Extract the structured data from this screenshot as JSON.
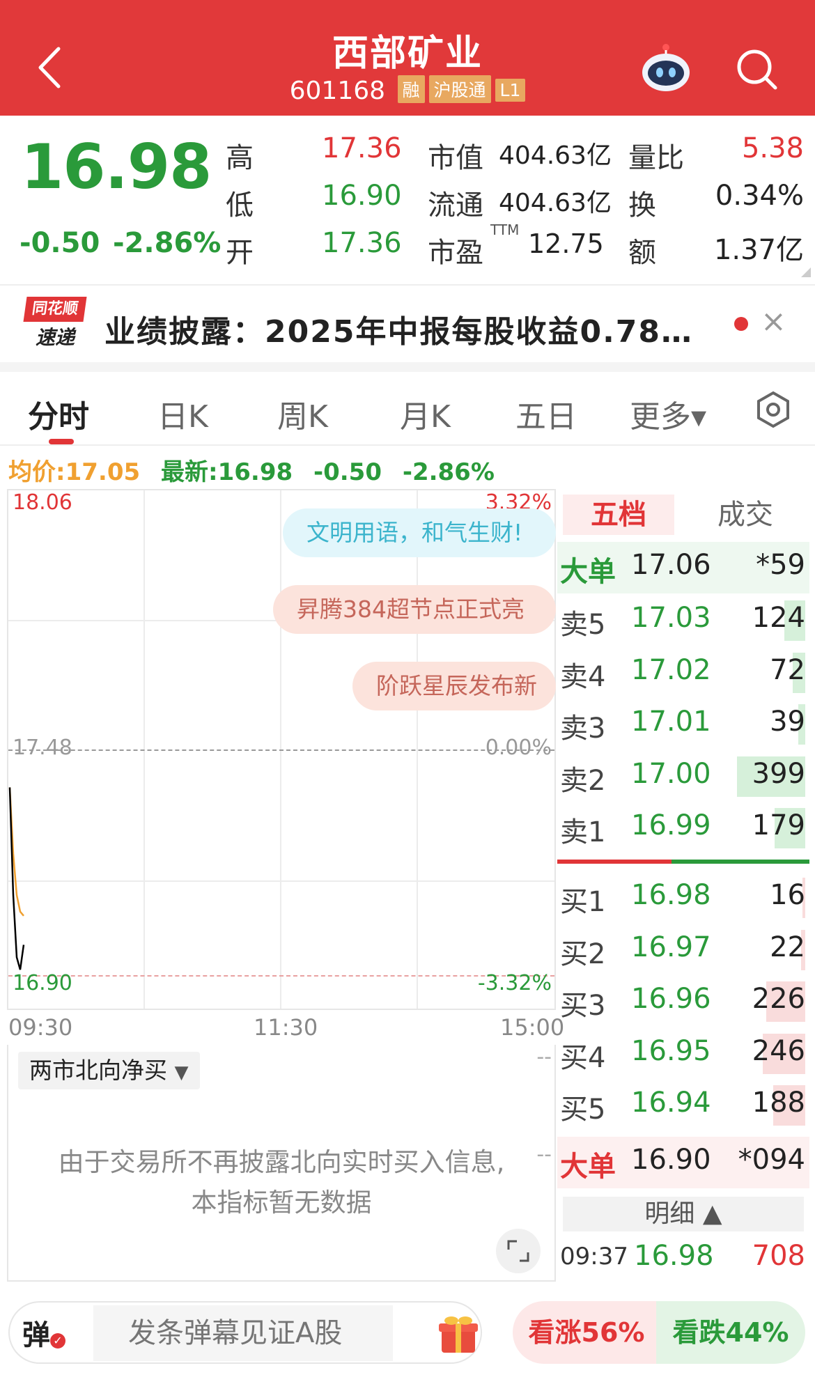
{
  "header": {
    "title": "西部矿业",
    "code": "601168",
    "tags": [
      "融",
      "沪股通",
      "L1"
    ]
  },
  "quote": {
    "price": "16.98",
    "change": "-0.50",
    "change_pct": "-2.86%",
    "high_label": "高",
    "high": "17.36",
    "low_label": "低",
    "low": "16.90",
    "open_label": "开",
    "open": "17.36",
    "mktcap_label": "市值",
    "mktcap": "404.63亿",
    "float_label": "流通",
    "float": "404.63亿",
    "pe_label": "市盈",
    "pe_sup": "TTM",
    "pe": "12.75",
    "vr_label": "量比",
    "vr": "5.38",
    "turnover_label": "换",
    "turnover": "0.34%",
    "amount_label": "额",
    "amount": "1.37亿"
  },
  "news": {
    "logo_top": "同花顺",
    "logo_bottom": "速递",
    "text": "业绩披露：2025年中报每股收益0.78…"
  },
  "tabs": [
    "分时",
    "日K",
    "周K",
    "月K",
    "五日",
    "更多▾"
  ],
  "summary": {
    "avg_label": "均价:",
    "avg": "17.05",
    "latest_label": "最新:",
    "latest": "16.98",
    "change": "-0.50",
    "change_pct": "-2.86%"
  },
  "chart_data": {
    "type": "line",
    "y_top": "18.06",
    "y_mid": "17.48",
    "y_bottom": "16.90",
    "pct_top": "3.32%",
    "pct_mid": "0.00%",
    "pct_bottom": "-3.32%",
    "x_ticks": [
      "09:30",
      "11:30",
      "15:00"
    ],
    "ylim": [
      16.9,
      18.06
    ],
    "series": [
      {
        "color": "#000000",
        "points": [
          [
            0,
            17.36
          ],
          [
            1,
            17.1
          ],
          [
            2,
            16.95
          ],
          [
            3,
            16.92
          ],
          [
            4,
            16.98
          ]
        ]
      },
      {
        "color": "#f0a030",
        "points": [
          [
            0,
            17.36
          ],
          [
            1,
            17.2
          ],
          [
            2,
            17.1
          ],
          [
            3,
            17.06
          ],
          [
            4,
            17.05
          ]
        ]
      }
    ]
  },
  "bubbles": [
    "文明用语，和气生财!",
    "昇腾384超节点正式亮",
    "阶跃星辰发布新"
  ],
  "north": {
    "select": "两市北向净买",
    "msg_line1": "由于交易所不再披露北向实时买入信息,",
    "msg_line2": "本指标暂无数据",
    "dashes": "--"
  },
  "orderbook": {
    "tab_active": "五档",
    "tab_other": "成交",
    "big_sell": {
      "label": "大单",
      "price": "17.06",
      "vol": "*59"
    },
    "asks": [
      {
        "label": "卖5",
        "price": "17.03",
        "vol": "124",
        "level": 0.31
      },
      {
        "label": "卖4",
        "price": "17.02",
        "vol": "72",
        "level": 0.18
      },
      {
        "label": "卖3",
        "price": "17.01",
        "vol": "39",
        "level": 0.1
      },
      {
        "label": "卖2",
        "price": "17.00",
        "vol": "399",
        "level": 1.0
      },
      {
        "label": "卖1",
        "price": "16.99",
        "vol": "179",
        "level": 0.45
      }
    ],
    "bids": [
      {
        "label": "买1",
        "price": "16.98",
        "vol": "16",
        "level": 0.04
      },
      {
        "label": "买2",
        "price": "16.97",
        "vol": "22",
        "level": 0.06
      },
      {
        "label": "买3",
        "price": "16.96",
        "vol": "226",
        "level": 0.57
      },
      {
        "label": "买4",
        "price": "16.95",
        "vol": "246",
        "level": 0.62
      },
      {
        "label": "买5",
        "price": "16.94",
        "vol": "188",
        "level": 0.47
      }
    ],
    "big_buy": {
      "label": "大单",
      "price": "16.90",
      "vol": "*094"
    },
    "detail_label": "明细 ▲",
    "trade": {
      "time": "09:37",
      "price": "16.98",
      "vol": "708"
    }
  },
  "bottom": {
    "danmu_icon": "弹",
    "placeholder": "发条弹幕见证A股",
    "up": "看涨56%",
    "down": "看跌44%"
  },
  "colors": {
    "brand": "#e1393a",
    "up": "#e13537",
    "down": "#2a9a3a",
    "avg": "#f0a030"
  }
}
